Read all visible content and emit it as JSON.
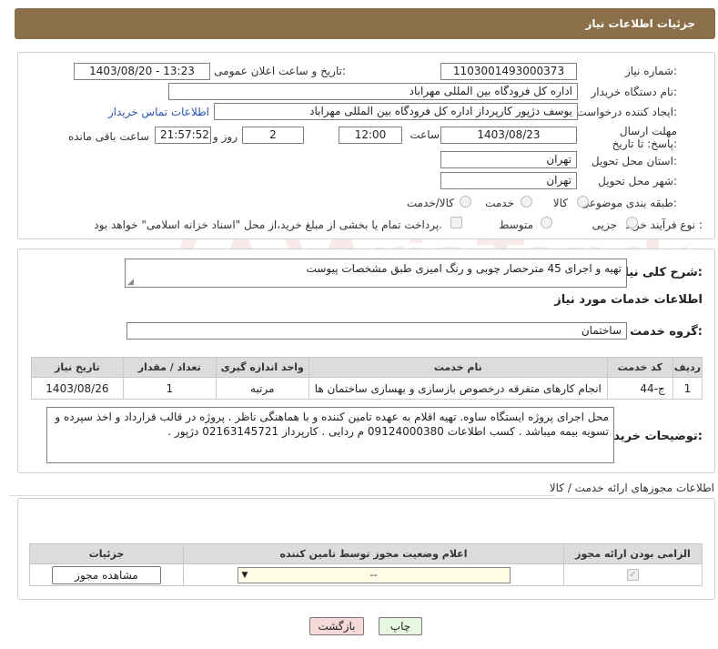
{
  "header": {
    "title": "جزئیات اطلاعات نیاز"
  },
  "form": {
    "need_number_label": "شماره نیاز:",
    "need_number": "1103001493000373",
    "announce_label": "تاریخ و ساعت اعلان عمومی:",
    "announce_value": "1403/08/20 - 13:23",
    "buyer_org_label": "نام دستگاه خریدار:",
    "buyer_org": "اداره کل فرودگاه بین المللی مهراباد",
    "creator_label": "ایجاد کننده درخواست:",
    "creator": "یوسف دژپور کارپرداز اداره کل فرودگاه بین المللی مهراباد",
    "contact_link": "اطلاعات تماس خریدار",
    "deadline_label": "مهلت ارسال پاسخ: تا تاریخ:",
    "deadline_date": "1403/08/23",
    "time_label": "ساعت",
    "deadline_time": "12:00",
    "days": "2",
    "days_label": "روز و",
    "remaining": "21:57:52",
    "remaining_label": "ساعت باقی مانده",
    "province_label": "استان محل تحویل:",
    "province": "تهران",
    "city_label": "شهر محل تحویل:",
    "city": "تهران",
    "category_label": "طبقه بندی موضوعی:",
    "category_options": [
      "کالا",
      "خدمت",
      "کالا/خدمت"
    ],
    "process_label": "نوع فرآیند خرید :",
    "process_options": [
      "جزیی",
      "متوسط"
    ],
    "payment_note": "پرداخت تمام یا بخشی از مبلغ خرید،از محل \"اسناد خزانه اسلامی\" خواهد بود."
  },
  "description": {
    "label": "شرح کلی نیاز:",
    "value": "تهیه و اجرای 45 مترحصار چوبی و رنگ امیزی طبق مشخصات پیوست"
  },
  "services": {
    "title": "اطلاعات خدمات مورد نیاز",
    "group_label": "گروه خدمت:",
    "group_value": "ساختمان",
    "table": {
      "headers": [
        "ردیف",
        "کد خدمت",
        "نام خدمت",
        "واحد اندازه گیری",
        "تعداد / مقدار",
        "تاریخ نیاز"
      ],
      "rows": [
        [
          "1",
          "ج-44",
          "انجام کارهای متفرقه درخصوص بازسازی و بهسازی ساختمان ها",
          "مرتبه",
          "1",
          "1403/08/26"
        ]
      ]
    }
  },
  "buyer_notes": {
    "label": "توضیحات خریدار:",
    "value": "محل اجرای پروژه ایستگاه ساوه. تهیه اقلام به عهده تامین کننده و با هماهنگی ناظر . پروژه در قالب قرارداد و اخذ سپرده و تسویه بیمه میباشد . کسب اطلاعات 09124000380 م ردایی . کارپرداز 02163145721 دژپور ."
  },
  "permits": {
    "title": "اطلاعات مجوزهای ارائه خدمت / کالا",
    "headers": [
      "الزامی بودن ارائه مجوز",
      "اعلام وضعیت مجوز توسط تامین کننده",
      "جزئیات"
    ],
    "select_value": "--",
    "view_button": "مشاهده مجوز"
  },
  "footer": {
    "print_button": "چاپ",
    "back_button": "بازگشت"
  },
  "watermark": "AriaTender.neT",
  "colors": {
    "header_bg": "#8b6f4a",
    "link": "#2a55b0",
    "back_btn_bg": "#f6d9d9",
    "print_btn_bg": "#e5f7de"
  }
}
